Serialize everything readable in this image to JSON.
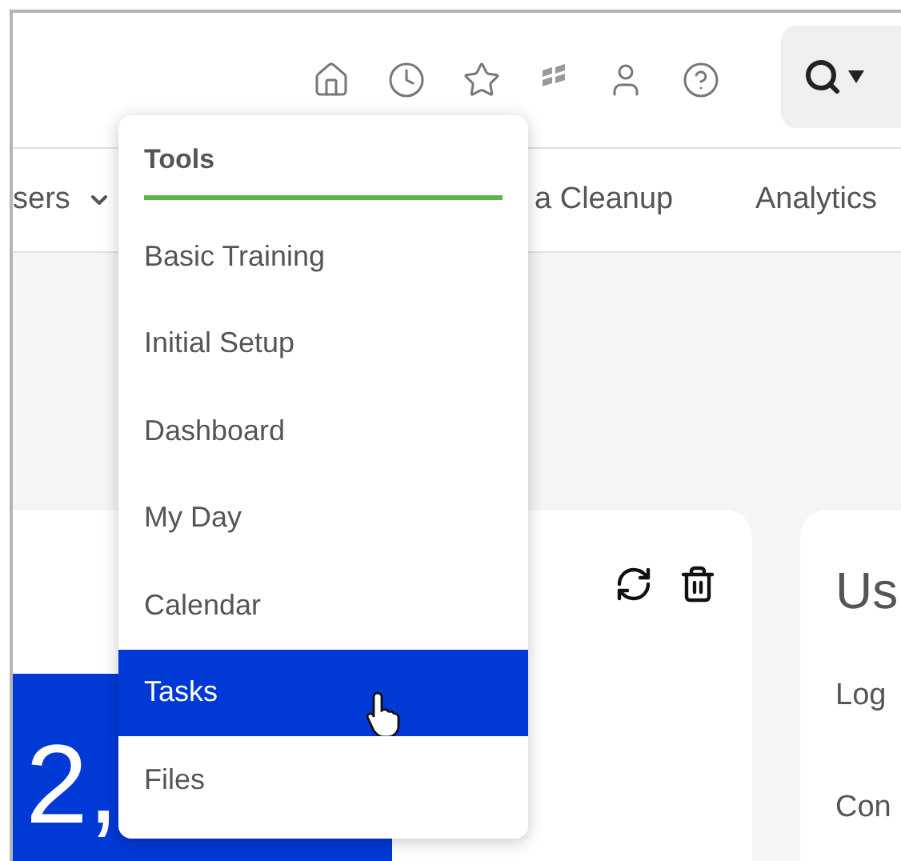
{
  "nav": {
    "items": [
      {
        "label": "sers",
        "dropdown": true
      },
      {
        "label": "a Cleanup",
        "dropdown": false
      },
      {
        "label": "Analytics",
        "dropdown": false
      }
    ]
  },
  "menu": {
    "title": "Tools",
    "items": [
      {
        "label": "Basic Training",
        "selected": false
      },
      {
        "label": "Initial Setup",
        "selected": false
      },
      {
        "label": "Dashboard",
        "selected": false
      },
      {
        "label": "My Day",
        "selected": false
      },
      {
        "label": "Calendar",
        "selected": false
      },
      {
        "label": "Tasks",
        "selected": true
      },
      {
        "label": "Files",
        "selected": false
      }
    ]
  },
  "stat_card": {
    "value": "2,"
  },
  "side_card": {
    "title": "Us",
    "rows": [
      "Log",
      "Con"
    ]
  }
}
